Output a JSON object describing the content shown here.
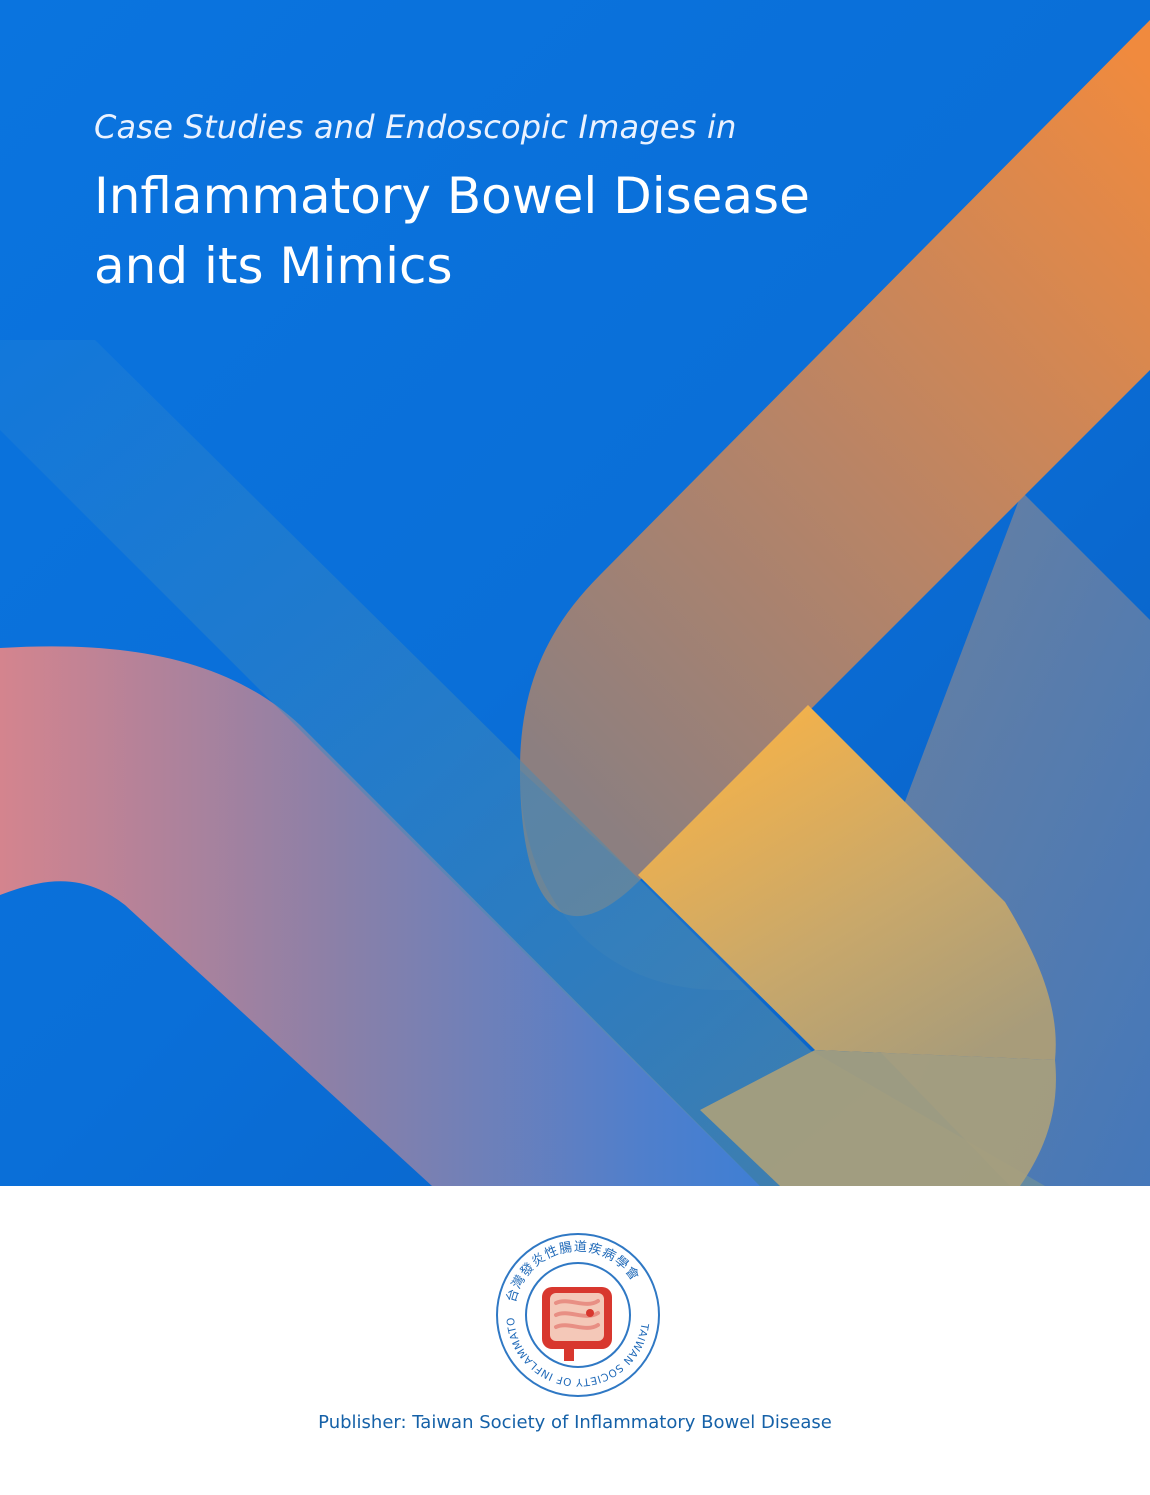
{
  "cover": {
    "subtitle": "Case Studies and Endoscopic Images in",
    "title_line1": "Inflammatory Bowel Disease",
    "title_line2": "and its Mimics"
  },
  "logo": {
    "chinese_name": "台灣發炎性腸道疾病學會",
    "english_name": "TAIWAN SOCIETY OF INFLAMMATORY BOWEL DISEASE"
  },
  "publisher": {
    "text": "Publisher: Taiwan Society of Inflammatory Bowel Disease"
  },
  "colors": {
    "background_blue": "#0a6fd8",
    "accent_orange": "#ee8640",
    "accent_pink": "#d4848e",
    "accent_yellow": "#fbb446",
    "publisher_text": "#1561a8",
    "logo_red": "#d8372e"
  }
}
